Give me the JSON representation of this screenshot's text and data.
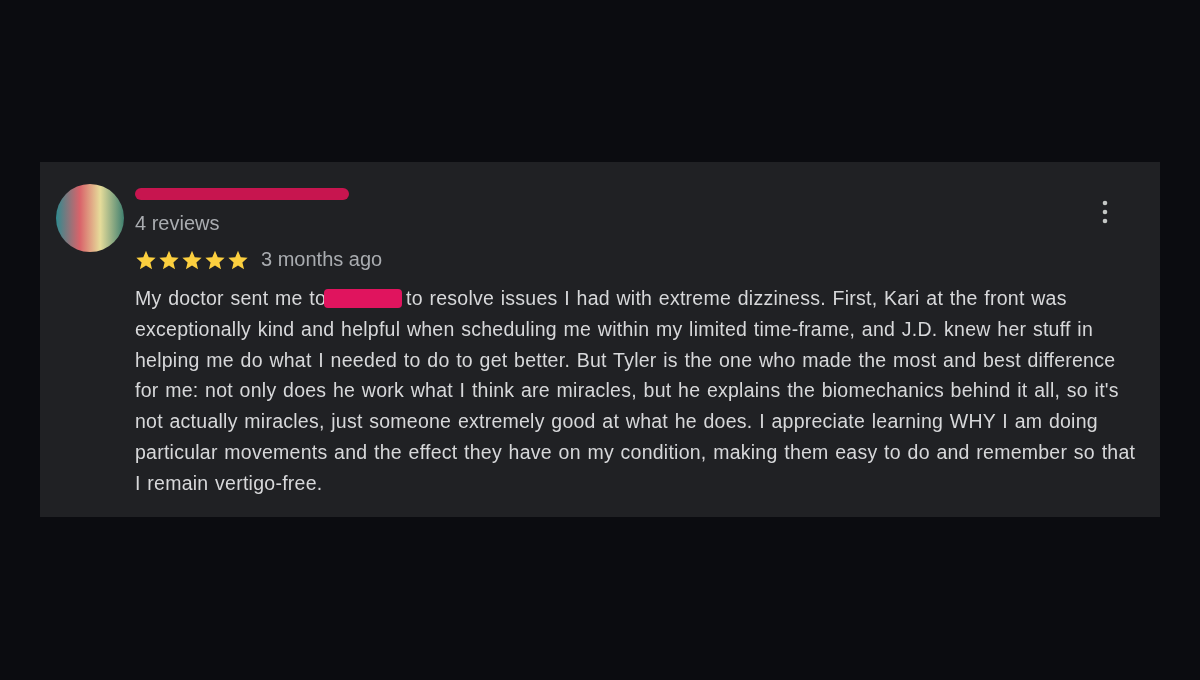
{
  "review": {
    "reviewer_count": "4 reviews",
    "stars": 5,
    "time": "3 months ago",
    "text_before": "My doctor sent me to",
    "text_after": "to resolve issues I had with extreme dizziness. First, Kari at the front was exceptionally kind and helpful when scheduling me within my limited time-frame, and J.D. knew her stuff in helping me do what I needed to do to get better. But Tyler is the one who made the most and best difference for me: not only does he work what I think are miracles, but he explains the biomechanics behind it all, so it's not actually miracles, just someone extremely good at what he does. I appreciate learning WHY I am doing particular movements and the effect they have on my condition, making them easy to do and remember so that I remain vertigo-free."
  }
}
